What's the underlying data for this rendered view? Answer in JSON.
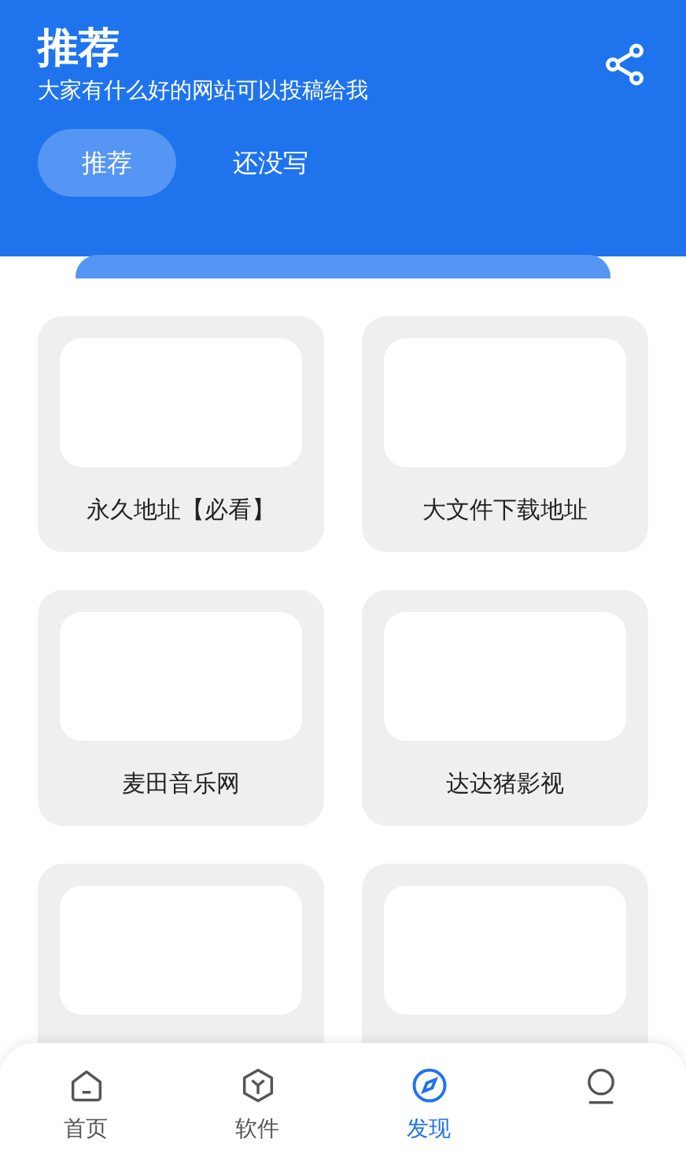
{
  "header": {
    "title": "推荐",
    "subtitle": "大家有什么好的网站可以投稿给我"
  },
  "tabs": [
    {
      "label": "推荐",
      "selected": true
    },
    {
      "label": "还没写",
      "selected": false
    }
  ],
  "cards": [
    {
      "kind": "site",
      "label": "永久地址【必看】"
    },
    {
      "kind": "site",
      "label": "大文件下载地址"
    },
    {
      "kind": "site",
      "label": "麦田音乐网"
    },
    {
      "kind": "site",
      "label": "达达猪影视"
    },
    {
      "kind": "site"
    },
    {
      "kind": "site"
    }
  ],
  "bottom_nav": [
    {
      "label": "首页",
      "selected": false
    },
    {
      "label": "软件",
      "selected": false
    },
    {
      "label": "发现",
      "selected": true
    },
    {
      "selected": false
    }
  ]
}
